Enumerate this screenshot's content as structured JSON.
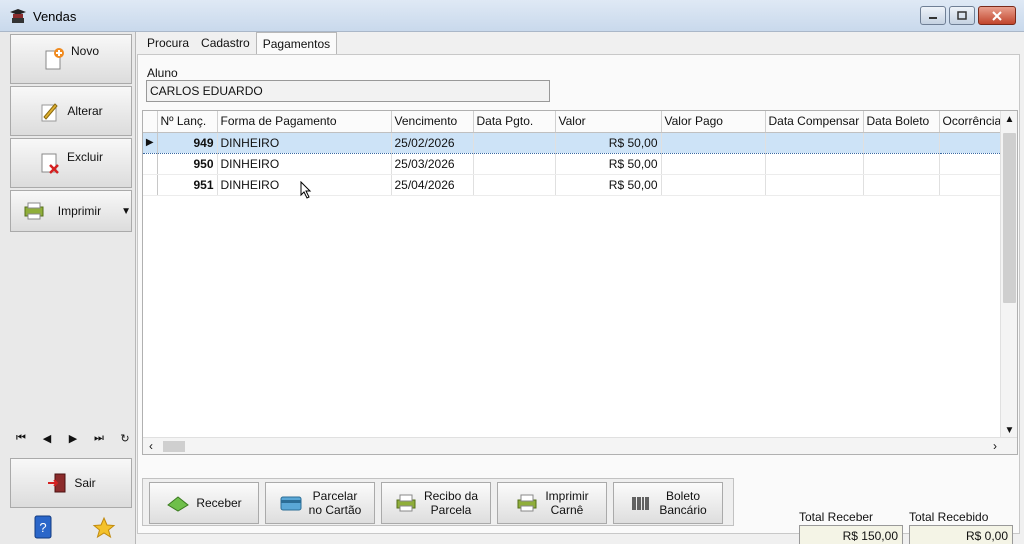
{
  "window": {
    "title": "Vendas"
  },
  "sidebar": {
    "novo": "Novo",
    "alterar": "Alterar",
    "excluir": "Excluir",
    "imprimir": "Imprimir",
    "sair": "Sair"
  },
  "tabs": [
    "Procura",
    "Cadastro",
    "Pagamentos"
  ],
  "active_tab": "Pagamentos",
  "aluno": {
    "label": "Aluno",
    "value": "CARLOS EDUARDO"
  },
  "grid": {
    "columns": [
      "Nº Lanç.",
      "Forma de Pagamento",
      "Vencimento",
      "Data Pgto.",
      "Valor",
      "Valor Pago",
      "Data Compensar",
      "Data Boleto",
      "Ocorrência"
    ],
    "rows": [
      {
        "lanc": "949",
        "forma": "DINHEIRO",
        "vencimento": "25/02/2026",
        "data_pgto": "",
        "valor": "R$ 50,00",
        "valor_pago": "",
        "data_compensar": "",
        "data_boleto": "",
        "ocorrencia": ""
      },
      {
        "lanc": "950",
        "forma": "DINHEIRO",
        "vencimento": "25/03/2026",
        "data_pgto": "",
        "valor": "R$ 50,00",
        "valor_pago": "",
        "data_compensar": "",
        "data_boleto": "",
        "ocorrencia": ""
      },
      {
        "lanc": "951",
        "forma": "DINHEIRO",
        "vencimento": "25/04/2026",
        "data_pgto": "",
        "valor": "R$ 50,00",
        "valor_pago": "",
        "data_compensar": "",
        "data_boleto": "",
        "ocorrencia": ""
      }
    ],
    "selected_row": 0
  },
  "actions": {
    "receber": "Receber",
    "parcelar_1": "Parcelar",
    "parcelar_2": "no Cartão",
    "recibo_1": "Recibo da",
    "recibo_2": "Parcela",
    "carne_1": "Imprimir",
    "carne_2": "Carnê",
    "boleto_1": "Boleto",
    "boleto_2": "Bancário"
  },
  "totals": {
    "receber_label": "Total Receber",
    "receber_value": "R$ 150,00",
    "recebido_label": "Total Recebido",
    "recebido_value": "R$ 0,00"
  },
  "colors": {
    "selection": "#cde3f7",
    "close_button": "#c1452c"
  }
}
